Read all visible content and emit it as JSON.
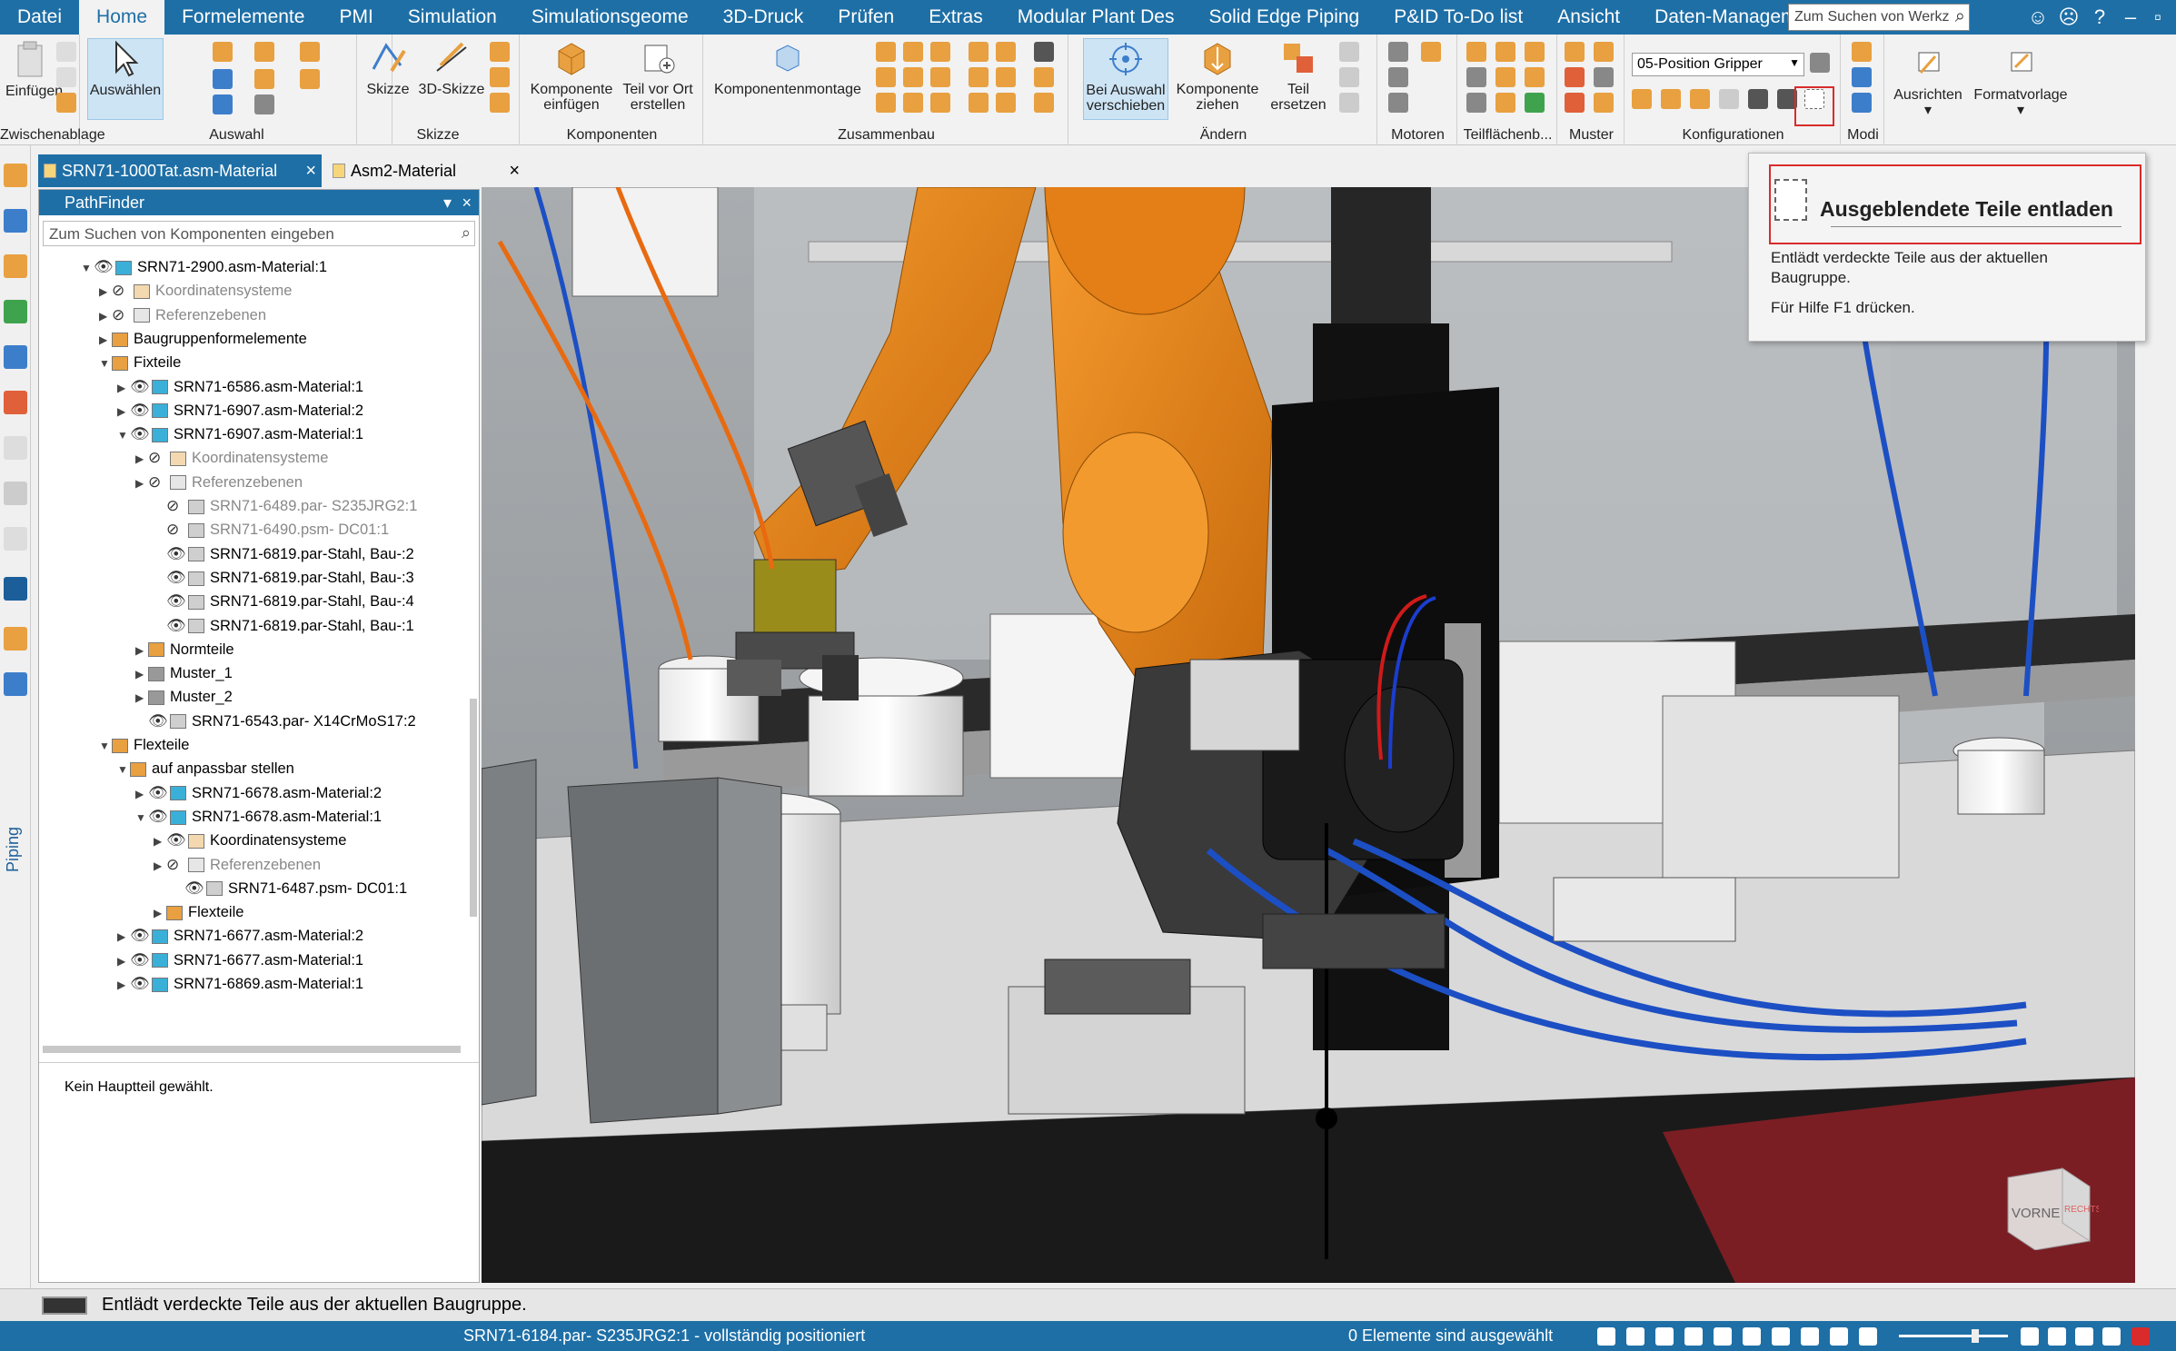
{
  "menu": {
    "items": [
      "Datei",
      "Home",
      "Formelemente",
      "PMI",
      "Simulation",
      "Simulationsgeome",
      "3D-Druck",
      "Prüfen",
      "Extras",
      "Modular Plant Des",
      "Solid Edge Piping",
      "P&ID To-Do list",
      "Ansicht",
      "Daten-Manageme"
    ],
    "active": "Home",
    "search_placeholder": "Zum Suchen von Werkz"
  },
  "ribbon": {
    "groups": {
      "zwischenablage": "Zwischenablage",
      "auswahl": "Auswahl",
      "skizze": "Skizze",
      "komponenten": "Komponenten",
      "zusammenbau": "Zusammenbau",
      "aendern": "Ändern",
      "motoren": "Motoren",
      "teilflaechen": "Teilflächenb...",
      "muster": "Muster",
      "konfigurationen": "Konfigurationen",
      "modi": "Modi"
    },
    "buttons": {
      "einfuegen": "Einfügen",
      "auswaehlen": "Auswählen",
      "skizze": "Skizze",
      "skizze3d": "3D-Skizze",
      "komponente_einfuegen_1": "Komponente",
      "komponente_einfuegen_2": "einfügen",
      "teil_vor_ort_1": "Teil vor Ort",
      "teil_vor_ort_2": "erstellen",
      "komponentenmontage": "Komponentenmontage",
      "bei_auswahl_1": "Bei Auswahl",
      "bei_auswahl_2": "verschieben",
      "komponente_ziehen_1": "Komponente",
      "komponente_ziehen_2": "ziehen",
      "teil_ersetzen_1": "Teil",
      "teil_ersetzen_2": "ersetzen",
      "ausrichten": "Ausrichten",
      "formatvorlage": "Formatvorlage"
    },
    "config_select": "05-Position Gripper"
  },
  "tabs": [
    {
      "label": "SRN71-1000Tat.asm-Material",
      "active": true
    },
    {
      "label": "Asm2-Material",
      "active": false
    }
  ],
  "pathfinder": {
    "title": "PathFinder",
    "search_placeholder": "Zum Suchen von Komponenten eingeben",
    "nodes": [
      {
        "text": "SRN71-2900.asm-Material:1",
        "exp": "▼",
        "eye": "👁",
        "grey": false
      },
      {
        "text": "Koordinatensysteme",
        "exp": "▶",
        "eye": "⊘",
        "grey": true
      },
      {
        "text": "Referenzebenen",
        "exp": "▶",
        "eye": "⊘",
        "grey": true
      },
      {
        "text": "Baugruppenformelemente",
        "exp": "▶",
        "eye": "",
        "grey": false
      },
      {
        "text": "Fixteile",
        "exp": "▼",
        "eye": "",
        "grey": false
      },
      {
        "text": "SRN71-6586.asm-Material:1",
        "exp": "▶",
        "eye": "👁",
        "grey": false
      },
      {
        "text": "SRN71-6907.asm-Material:2",
        "exp": "▶",
        "eye": "👁",
        "grey": false
      },
      {
        "text": "SRN71-6907.asm-Material:1",
        "exp": "▼",
        "eye": "👁",
        "grey": false
      },
      {
        "text": "Koordinatensysteme",
        "exp": "▶",
        "eye": "⊘",
        "grey": true
      },
      {
        "text": "Referenzebenen",
        "exp": "▶",
        "eye": "⊘",
        "grey": true
      },
      {
        "text": "SRN71-6489.par- S235JRG2:1",
        "exp": "",
        "eye": "⊘",
        "grey": true
      },
      {
        "text": "SRN71-6490.psm- DC01:1",
        "exp": "",
        "eye": "⊘",
        "grey": true
      },
      {
        "text": "SRN71-6819.par-Stahl, Bau-:2",
        "exp": "",
        "eye": "👁",
        "grey": false
      },
      {
        "text": "SRN71-6819.par-Stahl, Bau-:3",
        "exp": "",
        "eye": "👁",
        "grey": false
      },
      {
        "text": "SRN71-6819.par-Stahl, Bau-:4",
        "exp": "",
        "eye": "👁",
        "grey": false
      },
      {
        "text": "SRN71-6819.par-Stahl, Bau-:1",
        "exp": "",
        "eye": "👁",
        "grey": false
      },
      {
        "text": "Normteile",
        "exp": "▶",
        "eye": "",
        "grey": false
      },
      {
        "text": "Muster_1",
        "exp": "▶",
        "eye": "",
        "grey": false
      },
      {
        "text": "Muster_2",
        "exp": "▶",
        "eye": "",
        "grey": false
      },
      {
        "text": "SRN71-6543.par- X14CrMoS17:2",
        "exp": "",
        "eye": "👁",
        "grey": false
      },
      {
        "text": "Flexteile",
        "exp": "▼",
        "eye": "",
        "grey": false
      },
      {
        "text": "auf anpassbar stellen",
        "exp": "▼",
        "eye": "",
        "grey": false
      },
      {
        "text": "SRN71-6678.asm-Material:2",
        "exp": "▶",
        "eye": "👁",
        "grey": false
      },
      {
        "text": "SRN71-6678.asm-Material:1",
        "exp": "▼",
        "eye": "👁",
        "grey": false
      },
      {
        "text": "Koordinatensysteme",
        "exp": "▶",
        "eye": "👁",
        "grey": false
      },
      {
        "text": "Referenzebenen",
        "exp": "▶",
        "eye": "⊘",
        "grey": true
      },
      {
        "text": "SRN71-6487.psm- DC01:1",
        "exp": "",
        "eye": "👁",
        "grey": false
      },
      {
        "text": "Flexteile",
        "exp": "▶",
        "eye": "",
        "grey": false
      },
      {
        "text": "SRN71-6677.asm-Material:2",
        "exp": "▶",
        "eye": "👁",
        "grey": false
      },
      {
        "text": "SRN71-6677.asm-Material:1",
        "exp": "▶",
        "eye": "👁",
        "grey": false
      },
      {
        "text": "SRN71-6869.asm-Material:1",
        "exp": "▶",
        "eye": "👁",
        "grey": false
      }
    ],
    "bottom_text": "Kein Hauptteil gewählt."
  },
  "left_toolbar": {
    "piping": "Piping"
  },
  "tooltip": {
    "title": "Ausgeblendete Teile entladen",
    "description": "Entlädt verdeckte Teile aus der aktuellen Baugruppe.",
    "help": "Für Hilfe F1 drücken."
  },
  "viewcube": {
    "front": "VORNE",
    "right": "RECHTS"
  },
  "prompt": {
    "text": "Entlädt verdeckte Teile aus der aktuellen Baugruppe."
  },
  "status": {
    "part": "SRN71-6184.par- S235JRG2:1 - vollständig positioniert",
    "selection": "0 Elemente sind ausgewählt"
  },
  "colors": {
    "accent": "#1e6fa6",
    "highlight": "#d92b2b",
    "robot": "#f08a1c"
  }
}
